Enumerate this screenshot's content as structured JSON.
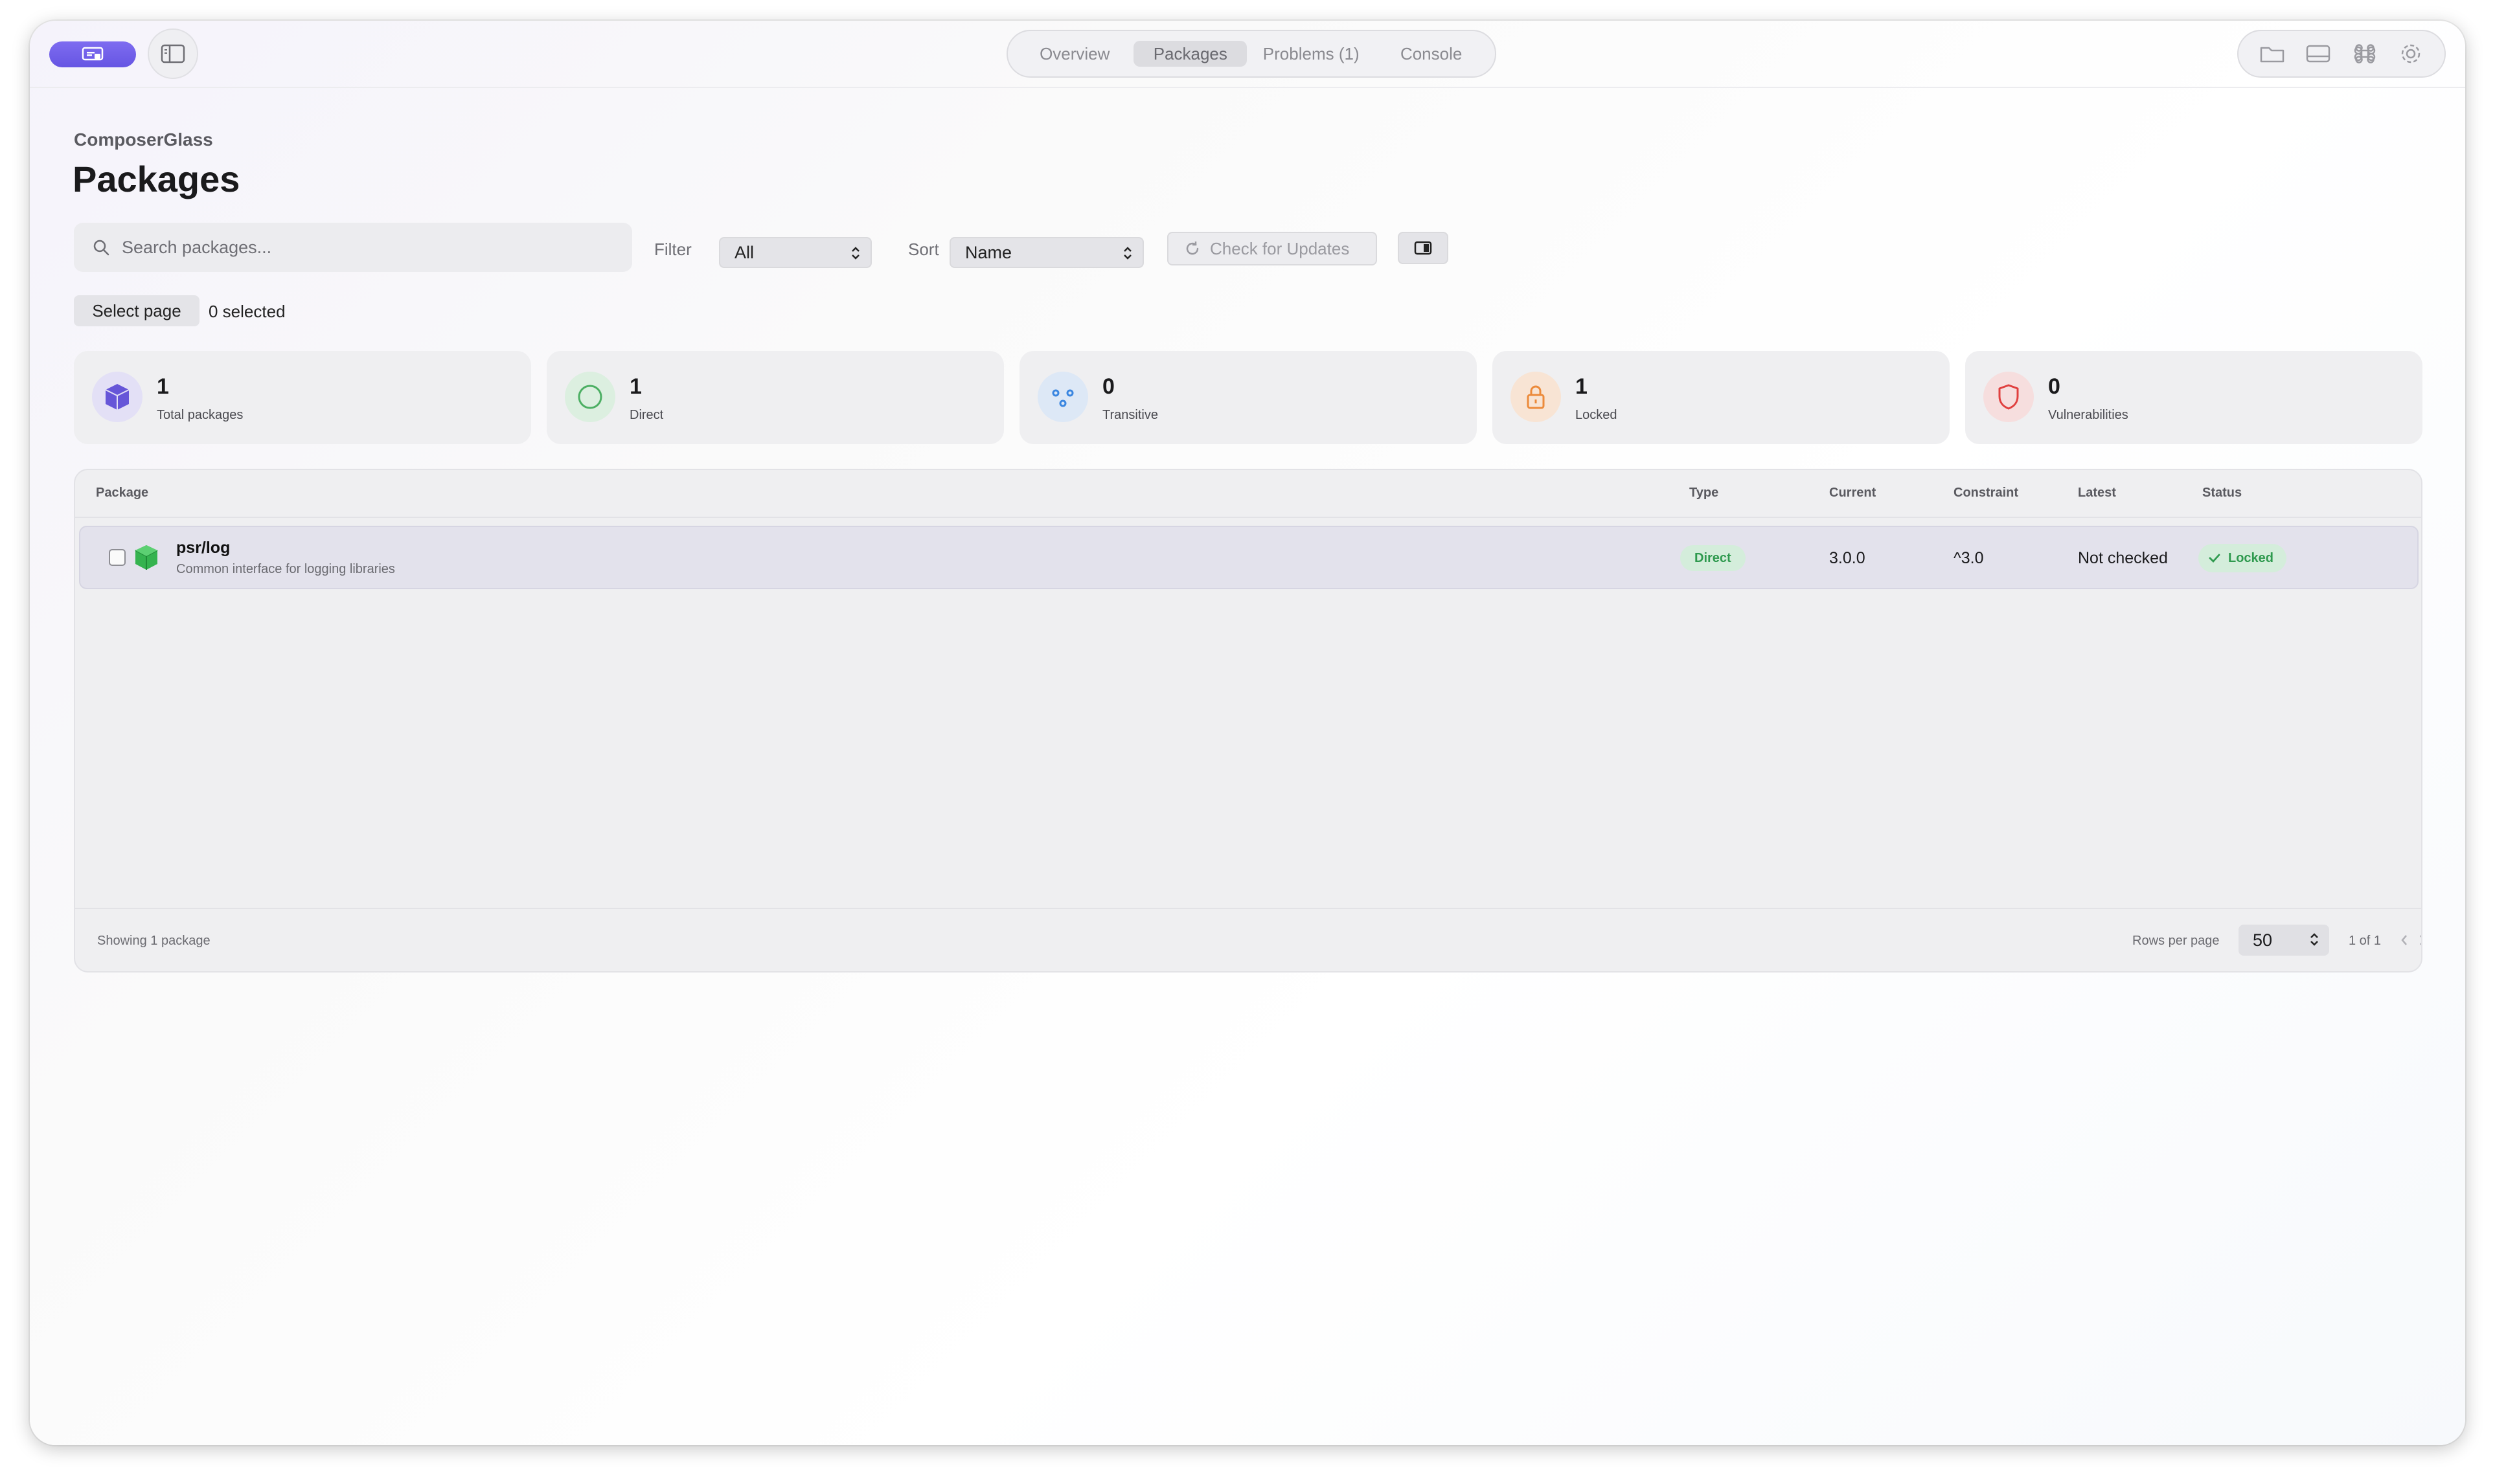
{
  "titlebar": {
    "tabs": [
      {
        "label": "Overview",
        "active": false
      },
      {
        "label": "Packages",
        "active": true
      },
      {
        "label": "Problems (1)",
        "active": false
      },
      {
        "label": "Console",
        "active": false
      }
    ],
    "tool_icons": [
      "folder-icon",
      "panel-bottom-icon",
      "command-icon",
      "gear-icon"
    ]
  },
  "header": {
    "breadcrumb": "ComposerGlass",
    "title": "Packages"
  },
  "toolbar": {
    "search_placeholder": "Search packages...",
    "filter_label": "Filter",
    "filter_value": "All",
    "sort_label": "Sort",
    "sort_value": "Name",
    "check_updates_label": "Check for Updates"
  },
  "selection": {
    "select_page_label": "Select page",
    "selected_count": "0 selected"
  },
  "stats": [
    {
      "value": "1",
      "label": "Total packages",
      "icon": "cube-icon",
      "color": "#6656d8",
      "bg": "#e3e0f6"
    },
    {
      "value": "1",
      "label": "Direct",
      "icon": "circle-icon",
      "color": "#4caf63",
      "bg": "#dcefe0"
    },
    {
      "value": "0",
      "label": "Transitive",
      "icon": "network-icon",
      "color": "#3a86e0",
      "bg": "#dde8f6"
    },
    {
      "value": "1",
      "label": "Locked",
      "icon": "lock-icon",
      "color": "#ec8a3a",
      "bg": "#f8e4d4"
    },
    {
      "value": "0",
      "label": "Vulnerabilities",
      "icon": "shield-icon",
      "color": "#e0403f",
      "bg": "#f6dede"
    }
  ],
  "table": {
    "columns": [
      "Package",
      "Type",
      "Current",
      "Constraint",
      "Latest",
      "Status"
    ],
    "rows": [
      {
        "name": "psr/log",
        "description": "Common interface for logging libraries",
        "type": "Direct",
        "current": "3.0.0",
        "constraint": "^3.0",
        "latest": "Not checked",
        "status": "Locked"
      }
    ],
    "footer": {
      "showing": "Showing 1 package",
      "rows_per_page_label": "Rows per page",
      "rows_per_page": "50",
      "page_indicator": "1 of 1"
    }
  },
  "colors": {
    "accent": "#6f5ee8",
    "success": "#2f9a4f",
    "success_bg": "#d4eddb"
  }
}
